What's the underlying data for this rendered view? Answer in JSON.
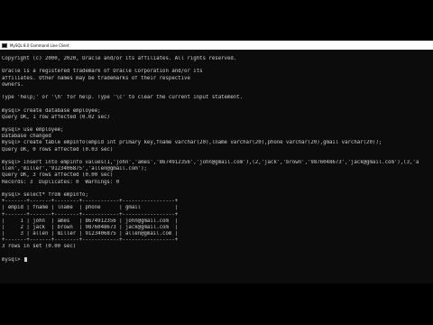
{
  "window": {
    "title": "MySQL 8.0 Command Line Client"
  },
  "colors": {
    "background": "#0c0c0c",
    "text": "#cccccc",
    "titlebar": "#ffffff"
  },
  "console": {
    "lines": [
      "Copyright (c) 2000, 2020, Oracle and/or its affiliates. All rights reserved.",
      "",
      "Oracle is a registered trademark of Oracle Corporation and/or its",
      "affiliates. Other names may be trademarks of their respective",
      "owners.",
      "",
      "Type 'help;' or '\\h' for help. Type '\\c' to clear the current input statement.",
      "",
      "mysql> create database employee;",
      "Query OK, 1 row affected (0.02 sec)",
      "",
      "mysql> use employee;",
      "Database changed",
      "mysql> create table empinfo(empid int primary key,fname varchar(20),lname varchar(20),phone varchar(20),gmail varchar(20));",
      "Query OK, 0 rows affected (0.03 sec)",
      "",
      "mysql> insert into empinfo values(1,'john','ames','8674912356','john@gmail.com'),(2,'jack','brown','9876048673','jack@gmail.com'),(3,'a",
      "llen','miller','9123406875','allen@gmail.com');",
      "Query OK, 3 rows affected (0.00 sec)",
      "Records: 3  Duplicates: 0  Warnings: 0",
      "",
      "mysql> select* from empinfo;",
      "+-------+-------+--------+------------+-----------------+",
      "| empid | fname | lname  | phone      | gmail           |",
      "+-------+-------+--------+------------+-----------------+",
      "|     1 | john  | ames   | 8674912356 | john@gmail.com  |",
      "|     2 | jack  | brown  | 9876048673 | jack@gmail.com  |",
      "|     3 | allen | miller | 9123406875 | allen@gmail.com |",
      "+-------+-------+--------+------------+-----------------+",
      "3 rows in set (0.00 sec)",
      "",
      "mysql> "
    ]
  }
}
